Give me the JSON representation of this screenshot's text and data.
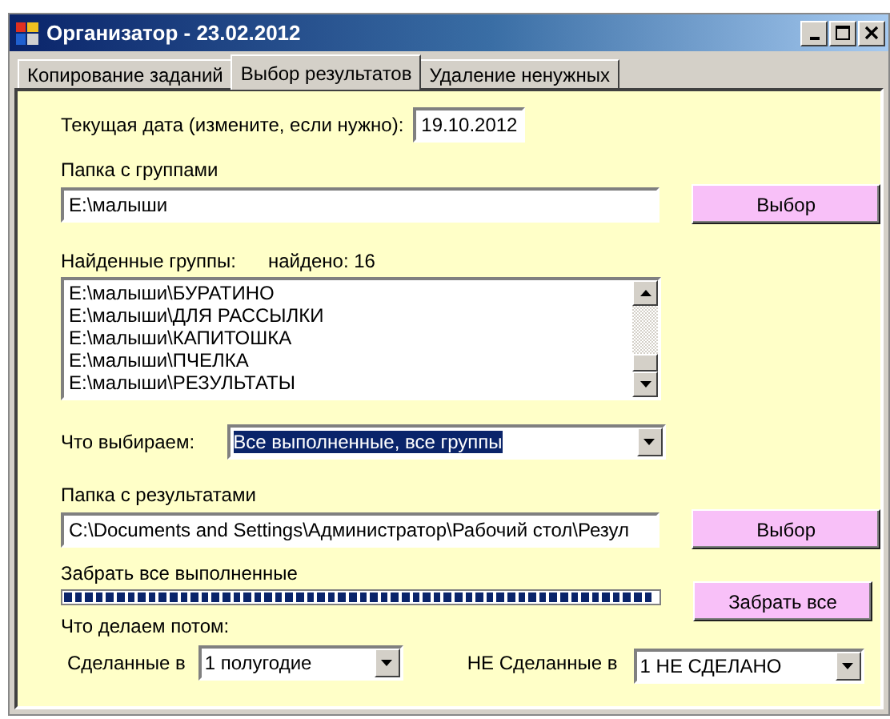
{
  "window": {
    "title": "Организатор - 23.02.2012"
  },
  "tabs": [
    {
      "label": "Копирование заданий",
      "selected": false
    },
    {
      "label": "Выбор результатов",
      "selected": true
    },
    {
      "label": "Удаление ненужных",
      "selected": false
    }
  ],
  "date": {
    "label": "Текущая дата (измените, если нужно):",
    "value": "19.10.2012"
  },
  "groups_folder": {
    "label": "Папка с группами",
    "value": "E:\\малыши",
    "button": "Выбор"
  },
  "found_groups": {
    "label": "Найденные группы:",
    "count": "найдено: 16",
    "items": [
      "E:\\малыши\\БУРАТИНО",
      "E:\\малыши\\ДЛЯ РАССЫЛКИ",
      "E:\\малыши\\КАПИТОШКА",
      "E:\\малыши\\ПЧЕЛКА",
      "E:\\малыши\\РЕЗУЛЬТАТЫ"
    ]
  },
  "choice": {
    "label": "Что выбираем:",
    "value": "Все выполненные, все группы"
  },
  "results_folder": {
    "label": "Папка с результатами",
    "value": "C:\\Documents and Settings\\Администратор\\Рабочий стол\\Резул",
    "button": "Выбор"
  },
  "collect": {
    "label": "Забрать все выполненные",
    "level": 1,
    "button": "Забрать все"
  },
  "after": {
    "label": "Что делаем потом:",
    "done_label": "Сделанные в",
    "done_value": "1 полугодие",
    "not_done_label": "НЕ Сделанные в",
    "not_done_value": "1 НЕ СДЕЛАНО"
  }
}
